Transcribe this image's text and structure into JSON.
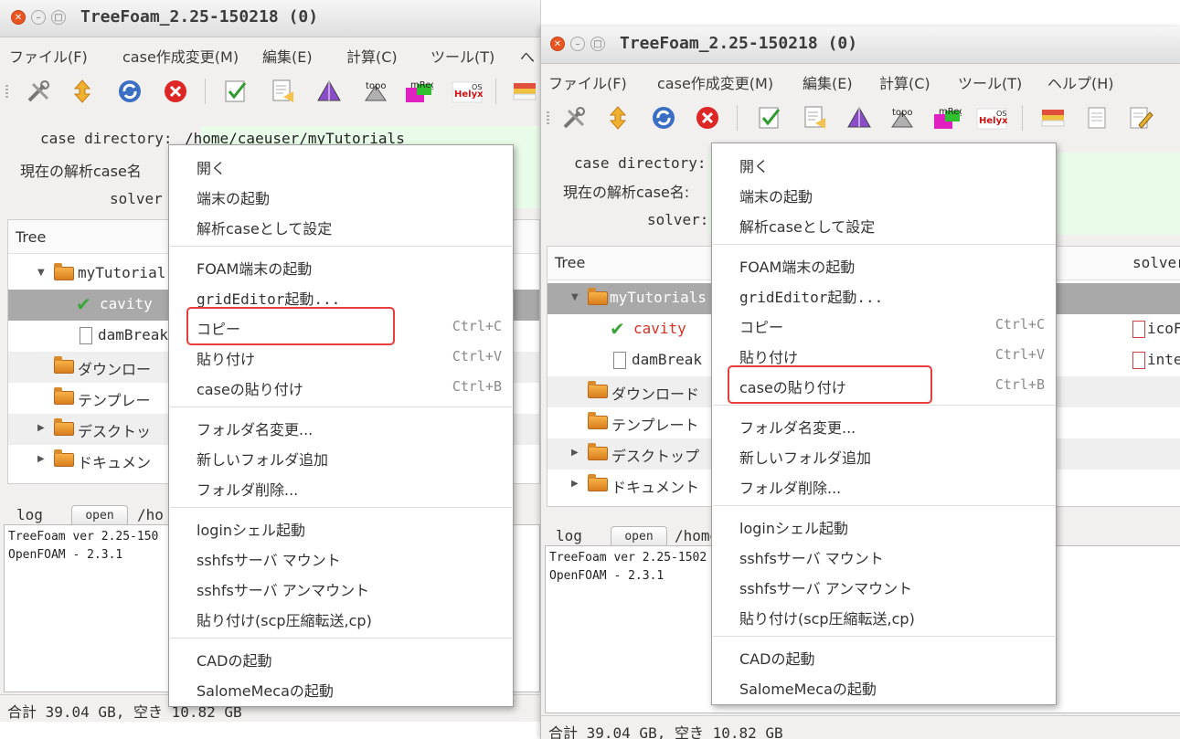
{
  "window_title": "TreeFoam_2.25-150218 (0)",
  "menubar": [
    "ファイル(F)",
    "case作成変更(M)",
    "編集(E)",
    "計算(C)",
    "ツール(T)",
    "ヘルプ(H)",
    "へ"
  ],
  "toolbar_icons": [
    "tools-icon",
    "updown-arrows-icon",
    "refresh-icon",
    "stop-icon",
    "checklist-icon",
    "notes-icon",
    "triangle-mesh-icon",
    "topo-icon",
    "mreg-icon",
    "helyx-os-icon",
    "grid-icon",
    "document-icon",
    "edit-icon"
  ],
  "info": {
    "case_dir_label": "case directory:",
    "case_dir_value": "/home/caeuser/myTutorials",
    "case_name_label": "現在の解析case名:",
    "case_name_label_cut": "現在の解析case名",
    "solver_label": "solver:",
    "solver_label_cut": "solver"
  },
  "tree": {
    "header": "Tree",
    "header_solver": "solver",
    "rows": {
      "myTutorials": "myTutorials",
      "myTutorials_cut": "myTutorial",
      "cavity": "cavity",
      "damBreak": "damBreak",
      "damBreak_cut": "damBreak",
      "download": "ダウンロード",
      "download_cut": "ダウンロー",
      "template": "テンプレート",
      "template_cut": "テンプレー",
      "desktop": "デスクトップ",
      "desktop_cut": "デスクトッ",
      "documents": "ドキュメント",
      "documents_cut": "ドキュメン"
    },
    "solver_values": [
      "icoF",
      "inte"
    ]
  },
  "log": {
    "label": "log",
    "open_button": "open",
    "path_cut_left": "/ho",
    "path_cut_right": "/home",
    "line1_left": "TreeFoam ver 2.25-150",
    "line1_right": "TreeFoam ver 2.25-1502",
    "line2": "OpenFOAM - 2.3.1"
  },
  "status": {
    "left": "合計 39.04 GB,  空き 10.82 GB",
    "right": "合計 39.04 GB,  空き 10.82 GB"
  },
  "context_menu": {
    "open": "開く",
    "terminal": "端末の起動",
    "set_case": "解析caseとして設定",
    "foam_terminal": "FOAM端末の起動",
    "grid_editor": "gridEditor起動...",
    "copy": "コピー",
    "copy_accel": "Ctrl+C",
    "paste": "貼り付け",
    "paste_accel": "Ctrl+V",
    "paste_case": "caseの貼り付け",
    "paste_case_accel": "Ctrl+B",
    "rename": "フォルダ名変更...",
    "new_folder": "新しいフォルダ追加",
    "delete_folder": "フォルダ削除...",
    "login_shell": "loginシェル起動",
    "sshfs_mount": "sshfsサーバ マウント",
    "sshfs_unmount": "sshfsサーバ アンマウント",
    "paste_scp": "貼り付け(scp圧縮転送,cp)",
    "cad": "CADの起動",
    "salome": "SalomeMecaの起動"
  },
  "highlights": {
    "left_menu_item": "コピー",
    "right_menu_item": "caseの貼り付け",
    "color": "#e83e3e"
  },
  "colors": {
    "selection_row": "#a9a9a9",
    "case_dir_bg": "#e9fbe9",
    "cavity_text": "#d93025",
    "close_button": "#e95420"
  },
  "icon_text": {
    "topo": "topo",
    "mreg": "mReg",
    "helyx": "Helyx",
    "os": "OS"
  }
}
